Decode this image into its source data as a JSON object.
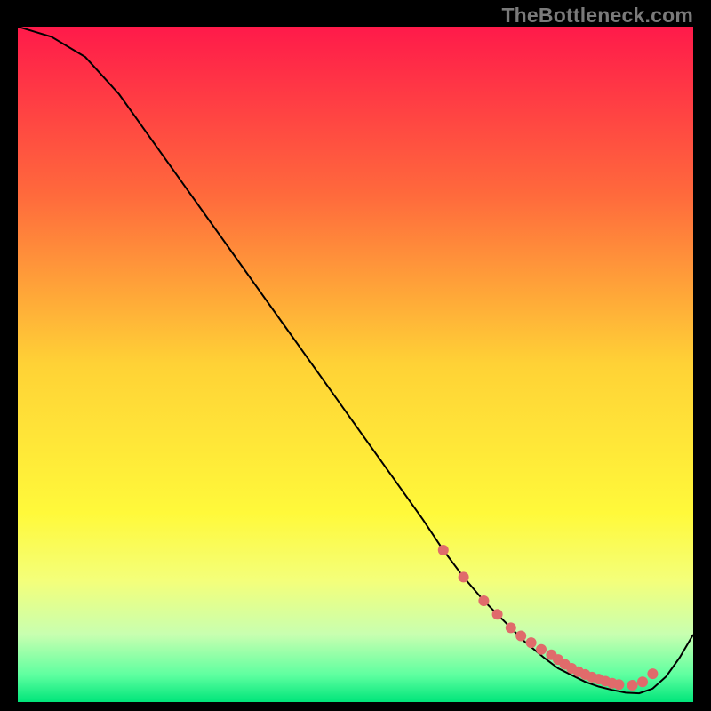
{
  "watermark": "TheBottleneck.com",
  "chart_data": {
    "type": "line",
    "title": "",
    "xlabel": "",
    "ylabel": "",
    "xlim": [
      0,
      100
    ],
    "ylim": [
      0,
      100
    ],
    "grid": false,
    "legend": false,
    "background_gradient_stops": [
      {
        "pos": 0.0,
        "color": "#ff1a4a"
      },
      {
        "pos": 0.25,
        "color": "#ff6a3c"
      },
      {
        "pos": 0.5,
        "color": "#ffd236"
      },
      {
        "pos": 0.72,
        "color": "#fff93a"
      },
      {
        "pos": 0.82,
        "color": "#f4ff7a"
      },
      {
        "pos": 0.9,
        "color": "#c8ffb0"
      },
      {
        "pos": 0.96,
        "color": "#5effa0"
      },
      {
        "pos": 1.0,
        "color": "#00e57a"
      }
    ],
    "series": [
      {
        "name": "curve",
        "color": "#000000",
        "x": [
          0,
          5,
          10,
          15,
          20,
          25,
          30,
          35,
          40,
          45,
          50,
          55,
          60,
          63,
          66,
          69,
          72,
          75,
          78,
          80,
          82,
          84,
          86,
          88,
          90,
          92,
          94,
          96,
          98,
          100
        ],
        "y": [
          100,
          98.5,
          95.5,
          90,
          83,
          76,
          69,
          62,
          55,
          48,
          41,
          34,
          27,
          22.5,
          18.5,
          15,
          12,
          9,
          6.5,
          5,
          4,
          3,
          2.3,
          1.8,
          1.4,
          1.3,
          2.0,
          3.8,
          6.6,
          10
        ]
      }
    ],
    "markers": {
      "color": "#e06b6b",
      "radius_px": 6,
      "x": [
        63,
        66,
        69,
        71,
        73,
        74.5,
        76,
        77.5,
        79,
        80,
        81,
        82,
        83,
        84,
        85,
        86,
        87,
        88,
        89,
        91,
        92.5,
        94
      ],
      "y": [
        22.5,
        18.5,
        15,
        13,
        11,
        9.8,
        8.8,
        7.8,
        7.0,
        6.3,
        5.6,
        5.0,
        4.5,
        4.1,
        3.7,
        3.4,
        3.1,
        2.8,
        2.6,
        2.5,
        3.0,
        4.2
      ]
    }
  }
}
